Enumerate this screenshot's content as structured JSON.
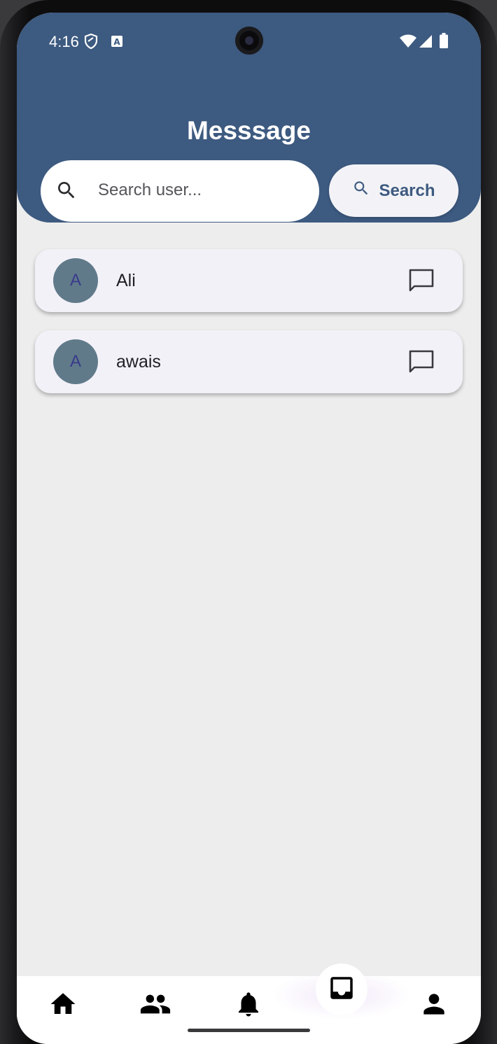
{
  "status_bar": {
    "time": "4:16"
  },
  "header": {
    "title": "Messsage"
  },
  "search": {
    "placeholder": "Search user...",
    "button_label": "Search"
  },
  "users": [
    {
      "initial": "A",
      "name": "Ali"
    },
    {
      "initial": "A",
      "name": "awais"
    }
  ],
  "bottom_nav": {
    "items": [
      "home-icon",
      "people-icon",
      "notifications-icon",
      "inbox-icon",
      "person-icon"
    ],
    "active": "inbox-icon"
  },
  "colors": {
    "header_bg": "#3d5a80",
    "page_bg": "#ededed",
    "card_bg": "#f3f1f8",
    "avatar_bg": "#607a8a",
    "accent": "#3d5a80"
  }
}
